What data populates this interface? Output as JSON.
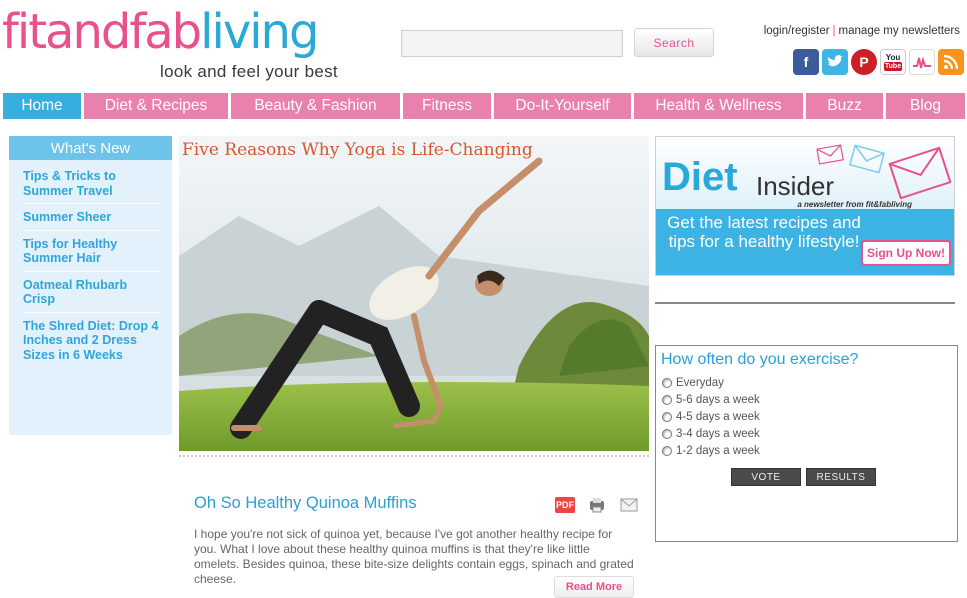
{
  "header": {
    "logo_part1": "fitand",
    "logo_part2": "fab",
    "logo_part3": "living",
    "tagline": "look and feel your best",
    "search_placeholder": "",
    "search_button": "Search",
    "login_register": "login/register",
    "manage_newsletters": "manage my newsletters",
    "social": [
      "facebook-icon",
      "twitter-icon",
      "pinterest-icon",
      "youtube-icon",
      "myspace-icon",
      "rss-icon"
    ]
  },
  "nav": [
    {
      "label": "Home",
      "active": true
    },
    {
      "label": "Diet & Recipes"
    },
    {
      "label": "Beauty & Fashion"
    },
    {
      "label": "Fitness"
    },
    {
      "label": "Do-It-Yourself"
    },
    {
      "label": "Health & Wellness"
    },
    {
      "label": "Buzz"
    },
    {
      "label": "Blog"
    }
  ],
  "whats_new": {
    "heading": "What's New",
    "items": [
      "Tips & Tricks to Summer Travel",
      "Summer Sheer",
      "Tips for Healthy Summer Hair",
      "Oatmeal Rhubarb Crisp",
      "The Shred Diet: Drop 4 Inches and 2 Dress Sizes in 6 Weeks"
    ]
  },
  "feature": {
    "title": "Five Reasons Why Yoga is Life-Changing"
  },
  "article": {
    "title": "Oh So Healthy Quinoa Muffins",
    "body": "I hope you're not sick of quinoa yet, because I've got another healthy recipe for you. What I love about these healthy quinoa muffins is that they're like little omelets. Besides quinoa, these bite-size delights contain eggs, spinach and grated cheese.",
    "read_more": "Read More",
    "icon_pdf_label": "PDF"
  },
  "diet_ad": {
    "diet": "Diet",
    "insider": "Insider",
    "sub": "a newsletter from fit&fabliving",
    "pitch": "Get the latest recipes and tips for a healthy lifestyle!",
    "signup": "Sign Up Now!"
  },
  "poll": {
    "question": "How often do you exercise?",
    "options": [
      "Everyday",
      "5-6 days a week",
      "4-5 days a week",
      "3-4 days a week",
      "1-2 days a week"
    ],
    "vote": "VOTE",
    "results": "RESULTS"
  },
  "colors": {
    "pink": "#e8508e",
    "blue": "#29a9d6",
    "nav_pink": "#e980ad",
    "nav_active": "#37aee0"
  }
}
